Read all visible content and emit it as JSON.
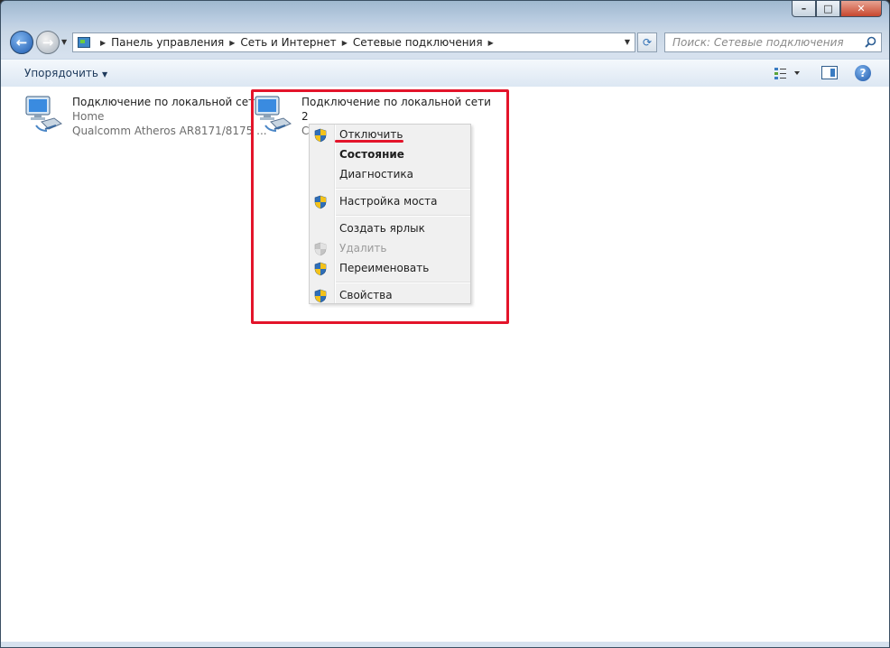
{
  "window": {
    "controls": {
      "minimize": "–",
      "maximize": "□",
      "close": "✕"
    }
  },
  "navigation": {
    "back_glyph": "←",
    "forward_glyph": "→",
    "breadcrumbs": [
      "Панель управления",
      "Сеть и Интернет",
      "Сетевые подключения"
    ],
    "search_placeholder": "Поиск: Сетевые подключения"
  },
  "toolbar": {
    "organize_label": "Упорядочить",
    "help_glyph": "?"
  },
  "connections": [
    {
      "name": "Подключение по локальной сети",
      "network": "Home",
      "adapter": "Qualcomm Atheros AR8171/8175 ..."
    },
    {
      "name_line1": "Подключение по локальной сети",
      "name_line2": "2",
      "network_partial": "С"
    }
  ],
  "context_menu": {
    "items": [
      {
        "label": "Отключить",
        "icon": "shield-icon",
        "style": "normal"
      },
      {
        "label": "Состояние",
        "icon": "",
        "style": "bold"
      },
      {
        "label": "Диагностика",
        "icon": "",
        "style": "normal"
      },
      {
        "label": "Настройка моста",
        "icon": "shield-icon",
        "style": "normal"
      },
      {
        "label": "Создать ярлык",
        "icon": "",
        "style": "normal"
      },
      {
        "label": "Удалить",
        "icon": "shield-icon",
        "style": "disabled"
      },
      {
        "label": "Переименовать",
        "icon": "shield-icon",
        "style": "normal"
      },
      {
        "label": "Свойства",
        "icon": "shield-icon",
        "style": "normal"
      }
    ]
  },
  "colors": {
    "annotation_red": "#e3142a",
    "accent_blue": "#1d57a8"
  }
}
